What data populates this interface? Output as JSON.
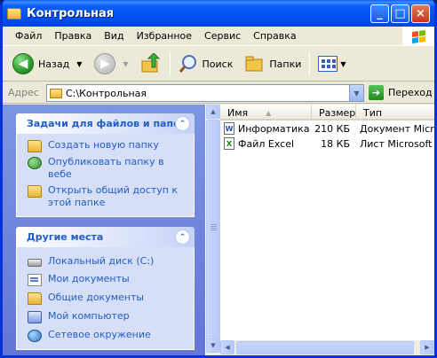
{
  "window": {
    "title": "Контрольная",
    "controls": {
      "minimize": "_",
      "maximize": "□",
      "close": "×"
    }
  },
  "menu": [
    "Файл",
    "Правка",
    "Вид",
    "Избранное",
    "Сервис",
    "Справка"
  ],
  "toolbar": {
    "back_label": "Назад",
    "search_label": "Поиск",
    "folders_label": "Папки"
  },
  "address": {
    "label": "Адрес",
    "value": "C:\\Контрольная",
    "go_label": "Переход"
  },
  "task_panels": [
    {
      "title": "Задачи для файлов и папок",
      "items": [
        {
          "label": "Создать новую папку",
          "icon": "new-folder-icon"
        },
        {
          "label": "Опубликовать папку в вебе",
          "icon": "publish-web-icon"
        },
        {
          "label": "Открыть общий доступ к этой папке",
          "icon": "share-folder-icon"
        }
      ]
    },
    {
      "title": "Другие места",
      "items": [
        {
          "label": "Локальный диск (C:)",
          "icon": "local-disk-icon"
        },
        {
          "label": "Мои документы",
          "icon": "my-documents-icon"
        },
        {
          "label": "Общие документы",
          "icon": "shared-documents-icon"
        },
        {
          "label": "Мой компьютер",
          "icon": "my-computer-icon"
        },
        {
          "label": "Сетевое окружение",
          "icon": "network-icon"
        }
      ]
    }
  ],
  "file_list": {
    "columns": [
      "Имя",
      "Размер",
      "Тип"
    ],
    "rows": [
      {
        "name": "Информатика",
        "size": "210 КБ",
        "type": "Документ Microsoft Word",
        "icon": "word-document-icon"
      },
      {
        "name": "Файл Excel",
        "size": "18 КБ",
        "type": "Лист Microsoft Excel",
        "icon": "excel-sheet-icon"
      }
    ]
  },
  "colors": {
    "titlebar": "#0054E3",
    "task_pane": "#6F84DD",
    "link": "#215DC6",
    "window_bg": "#ECE9D8"
  }
}
